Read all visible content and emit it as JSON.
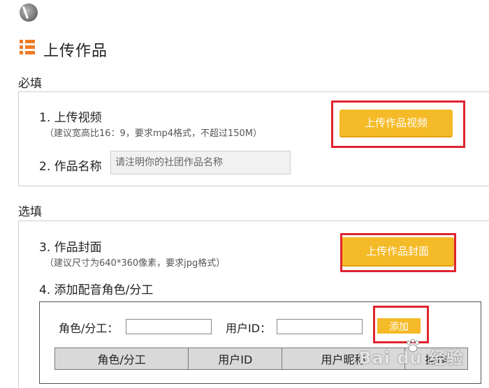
{
  "header": {
    "title": "上传作品"
  },
  "required_section": {
    "label": "必填",
    "upload_video": {
      "title": "1. 上传视频",
      "hint": "（建议宽高比16：9，要求mp4格式，不超过150M）",
      "button_label": "上传作品视频"
    },
    "work_name": {
      "title": "2. 作品名称",
      "placeholder": "请注明你的社团作品名称",
      "value": ""
    }
  },
  "optional_section": {
    "label": "选填",
    "cover": {
      "title": "3. 作品封面",
      "hint": "（建议尺寸为640*360像素，要求jpg格式）",
      "button_label": "上传作品封面"
    },
    "roles": {
      "title": "4. 添加配音角色/分工",
      "role_label": "角色/分工：",
      "role_value": "",
      "userid_label": "用户ID：",
      "userid_value": "",
      "add_button_label": "添加",
      "table_headers": [
        "角色/分工",
        "用户ID",
        "用户昵称",
        "操作"
      ]
    }
  },
  "watermark": "Bai du 经验",
  "colors": {
    "accent_orange": "#f5ba27",
    "icon_orange": "#f07b22",
    "highlight_red": "#e0242e"
  }
}
